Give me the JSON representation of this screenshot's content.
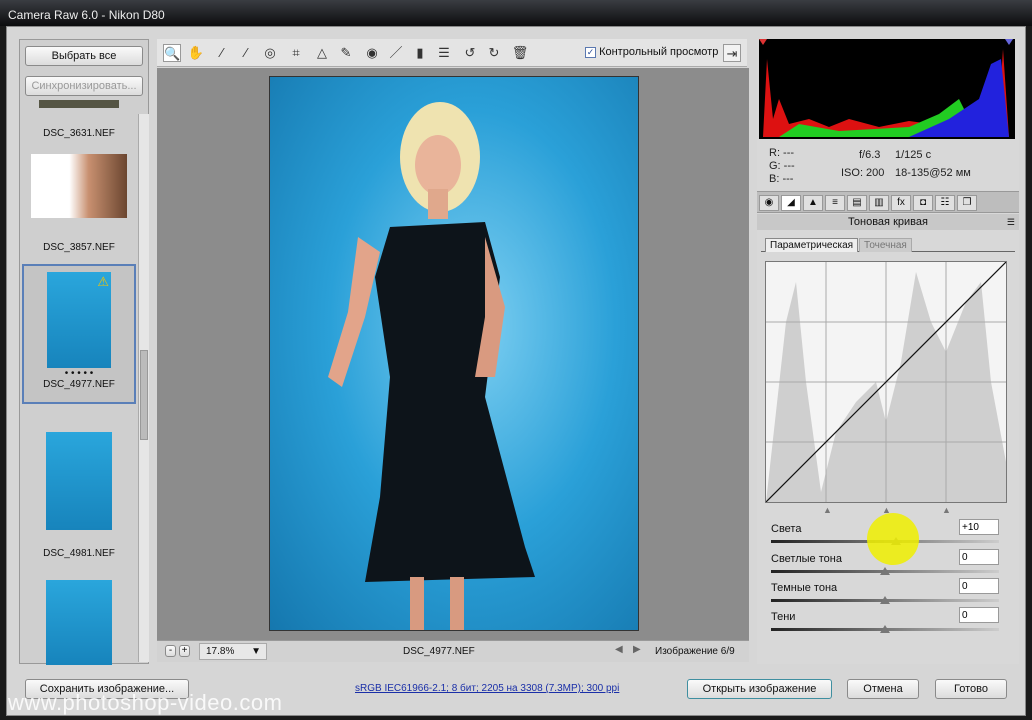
{
  "title": "Camera Raw 6.0  -  Nikon D80",
  "filmstrip": {
    "select_all": "Выбрать все",
    "sync": "Синхронизировать...",
    "items": [
      {
        "name": "DSC_3631.NEF"
      },
      {
        "name": "DSC_3857.NEF"
      },
      {
        "name": "DSC_4977.NEF",
        "selected": true,
        "rating": "• • • • •"
      },
      {
        "name": "DSC_4981.NEF"
      },
      {
        "name": ""
      }
    ]
  },
  "toolbar": {
    "preview_label": "Контрольный просмотр",
    "preview_checked": true,
    "tools": [
      "zoom-tool",
      "hand-tool",
      "white-balance-tool",
      "color-sampler-tool",
      "target-adjust-tool",
      "crop-tool",
      "straighten-tool",
      "spot-removal-tool",
      "red-eye-tool",
      "adjustment-brush-tool",
      "graduated-filter-tool",
      "preferences-tool",
      "rotate-left-tool",
      "rotate-right-tool",
      "trash-tool"
    ]
  },
  "status": {
    "zoom": "17.8%",
    "filename": "DSC_4977.NEF",
    "image_counter": "Изображение 6/9"
  },
  "info": {
    "r": "R:  ---",
    "g": "G:  ---",
    "b": "B:  ---",
    "aperture": "f/6.3",
    "shutter": "1/125 с",
    "iso": "ISO: 200",
    "lens": "18-135@52 мм"
  },
  "panel": {
    "title": "Тоновая кривая",
    "tab_parametric": "Параметрическая",
    "tab_point": "Точечная",
    "sliders": [
      {
        "label": "Света",
        "value": "+10",
        "pos": 0.55
      },
      {
        "label": "Светлые тона",
        "value": "0",
        "pos": 0.5
      },
      {
        "label": "Темные тона",
        "value": "0",
        "pos": 0.5
      },
      {
        "label": "Тени",
        "value": "0",
        "pos": 0.5
      }
    ]
  },
  "bottom": {
    "save": "Сохранить изображение...",
    "workflow": "sRGB IEC61966-2.1; 8 бит; 2205 на 3308 (7.3МР); 300 ppi",
    "open": "Открыть изображение",
    "cancel": "Отмена",
    "done": "Готово"
  },
  "watermark": "www.photoshop-video.com"
}
